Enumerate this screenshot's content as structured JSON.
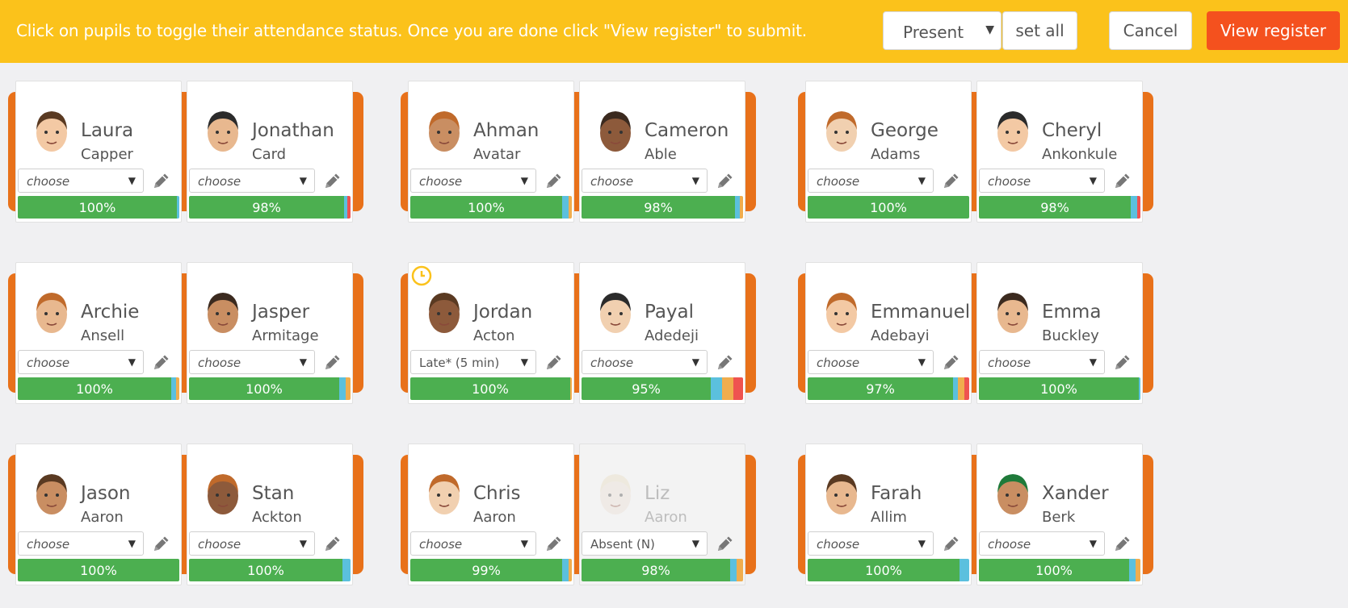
{
  "header": {
    "instruction": "Click on pupils to toggle their attendance status. Once you are done click \"View register\" to submit.",
    "status_select": "Present",
    "set_all_label": "set all",
    "cancel_label": "Cancel",
    "view_register_label": "View register"
  },
  "colors": {
    "header_bg": "#fbc21b",
    "group_bg": "#e8711a",
    "view_button": "#f4511e",
    "present": "#4caf50",
    "late": "#5bc0de",
    "authorised": "#f0ad4e",
    "absent": "#ef5350"
  },
  "icons": {
    "edit": "pencil-icon",
    "late": "clock-icon"
  },
  "pupils": [
    {
      "first": "Laura",
      "last": "Capper",
      "status": "choose",
      "pct": "100%",
      "segments": [
        {
          "c": "#4caf50",
          "v": 98.5
        },
        {
          "c": "#5bc0de",
          "v": 1.5
        }
      ]
    },
    {
      "first": "Jonathan",
      "last": "Card",
      "status": "choose",
      "pct": "98%",
      "segments": [
        {
          "c": "#4caf50",
          "v": 96
        },
        {
          "c": "#5bc0de",
          "v": 2
        },
        {
          "c": "#ef5350",
          "v": 2
        }
      ]
    },
    {
      "first": "Ahman",
      "last": "Avatar",
      "status": "choose",
      "pct": "100%",
      "segments": [
        {
          "c": "#4caf50",
          "v": 94
        },
        {
          "c": "#5bc0de",
          "v": 4
        },
        {
          "c": "#f0ad4e",
          "v": 2
        }
      ]
    },
    {
      "first": "Cameron",
      "last": "Able",
      "status": "choose",
      "pct": "98%",
      "segments": [
        {
          "c": "#4caf50",
          "v": 95
        },
        {
          "c": "#5bc0de",
          "v": 3
        },
        {
          "c": "#f0ad4e",
          "v": 2
        }
      ]
    },
    {
      "first": "George",
      "last": "Adams",
      "status": "choose",
      "pct": "100%",
      "segments": [
        {
          "c": "#4caf50",
          "v": 100
        }
      ]
    },
    {
      "first": "Cheryl",
      "last": "Ankonkule",
      "status": "choose",
      "pct": "98%",
      "segments": [
        {
          "c": "#4caf50",
          "v": 94
        },
        {
          "c": "#5bc0de",
          "v": 4
        },
        {
          "c": "#ef5350",
          "v": 2
        }
      ]
    },
    {
      "first": "Archie",
      "last": "Ansell",
      "status": "choose",
      "pct": "100%",
      "segments": [
        {
          "c": "#4caf50",
          "v": 95
        },
        {
          "c": "#5bc0de",
          "v": 3
        },
        {
          "c": "#f0ad4e",
          "v": 2
        }
      ]
    },
    {
      "first": "Jasper",
      "last": "Armitage",
      "status": "choose",
      "pct": "100%",
      "segments": [
        {
          "c": "#4caf50",
          "v": 93
        },
        {
          "c": "#5bc0de",
          "v": 4
        },
        {
          "c": "#f0ad4e",
          "v": 3
        }
      ]
    },
    {
      "first": "Jordan",
      "last": "Acton",
      "status": "Late* (5 min)",
      "pct": "100%",
      "late": true,
      "segments": [
        {
          "c": "#4caf50",
          "v": 99
        },
        {
          "c": "#f0ad4e",
          "v": 1
        }
      ]
    },
    {
      "first": "Payal",
      "last": "Adedeji",
      "status": "choose",
      "pct": "95%",
      "segments": [
        {
          "c": "#4caf50",
          "v": 80
        },
        {
          "c": "#5bc0de",
          "v": 7
        },
        {
          "c": "#f0ad4e",
          "v": 7
        },
        {
          "c": "#ef5350",
          "v": 6
        }
      ]
    },
    {
      "first": "Emmanuel",
      "last": "Adebayi",
      "status": "choose",
      "pct": "97%",
      "segments": [
        {
          "c": "#4caf50",
          "v": 90
        },
        {
          "c": "#5bc0de",
          "v": 3
        },
        {
          "c": "#f0ad4e",
          "v": 4
        },
        {
          "c": "#ef5350",
          "v": 3
        }
      ]
    },
    {
      "first": "Emma",
      "last": "Buckley",
      "status": "choose",
      "pct": "100%",
      "segments": [
        {
          "c": "#4caf50",
          "v": 99
        },
        {
          "c": "#5bc0de",
          "v": 1
        }
      ]
    },
    {
      "first": "Jason",
      "last": "Aaron",
      "status": "choose",
      "pct": "100%",
      "segments": [
        {
          "c": "#4caf50",
          "v": 100
        }
      ]
    },
    {
      "first": "Stan",
      "last": "Ackton",
      "status": "choose",
      "pct": "100%",
      "segments": [
        {
          "c": "#4caf50",
          "v": 95
        },
        {
          "c": "#5bc0de",
          "v": 5
        }
      ]
    },
    {
      "first": "Chris",
      "last": "Aaron",
      "status": "choose",
      "pct": "99%",
      "segments": [
        {
          "c": "#4caf50",
          "v": 94
        },
        {
          "c": "#5bc0de",
          "v": 4
        },
        {
          "c": "#f0ad4e",
          "v": 2
        }
      ]
    },
    {
      "first": "Liz",
      "last": "Aaron",
      "status": "Absent (N)",
      "pct": "98%",
      "dim": true,
      "segments": [
        {
          "c": "#4caf50",
          "v": 92
        },
        {
          "c": "#5bc0de",
          "v": 4
        },
        {
          "c": "#f0ad4e",
          "v": 4
        }
      ]
    },
    {
      "first": "Farah",
      "last": "Allim",
      "status": "choose",
      "pct": "100%",
      "segments": [
        {
          "c": "#4caf50",
          "v": 94
        },
        {
          "c": "#5bc0de",
          "v": 6
        }
      ]
    },
    {
      "first": "Xander",
      "last": "Berk",
      "status": "choose",
      "pct": "100%",
      "segments": [
        {
          "c": "#4caf50",
          "v": 93
        },
        {
          "c": "#5bc0de",
          "v": 4
        },
        {
          "c": "#f0ad4e",
          "v": 3
        }
      ]
    }
  ]
}
